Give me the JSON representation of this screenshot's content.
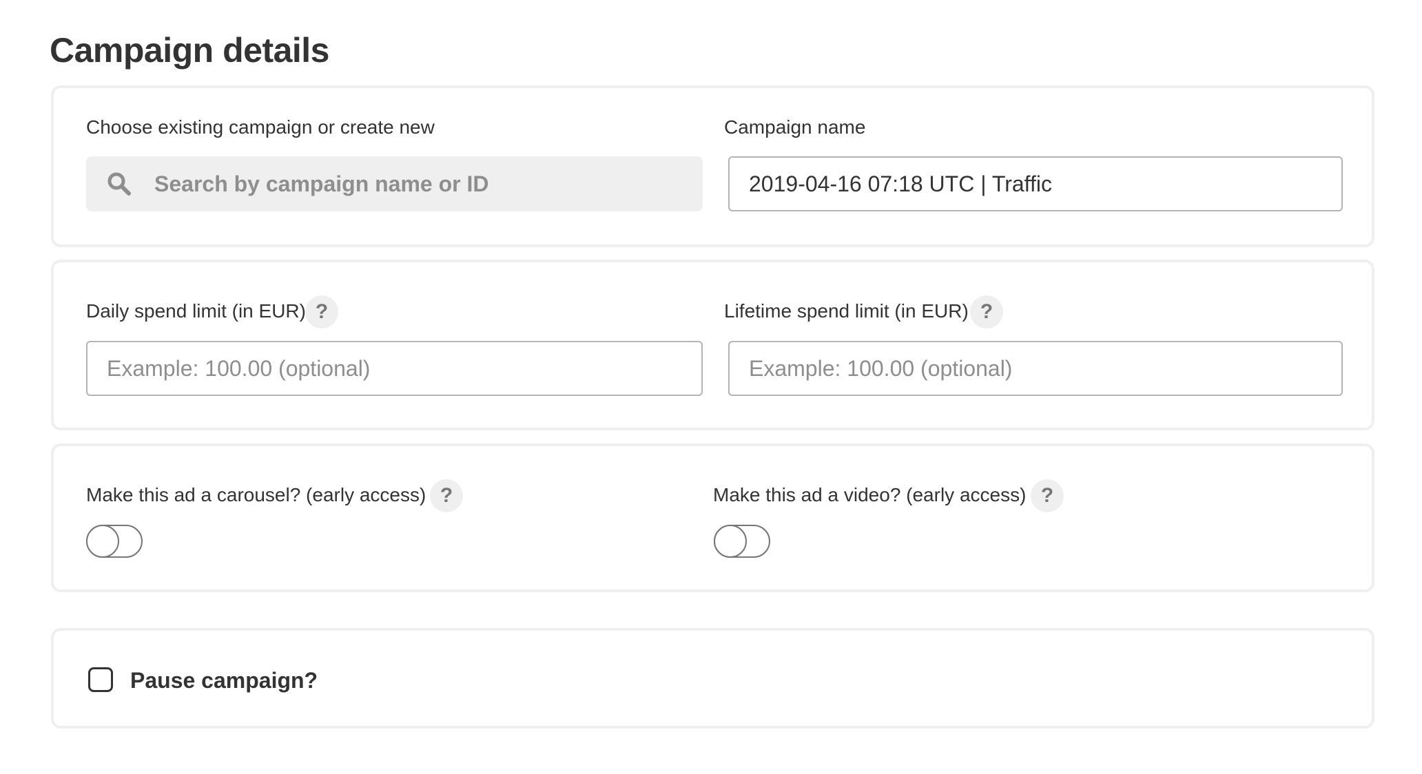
{
  "page": {
    "title": "Campaign details"
  },
  "campaign": {
    "existing_label": "Choose existing campaign or create new",
    "search_placeholder": "Search by campaign name or ID",
    "name_label": "Campaign name",
    "name_value": "2019-04-16 07:18 UTC | Traffic"
  },
  "spend": {
    "daily_label": "Daily spend limit (in EUR)",
    "daily_placeholder": "Example: 100.00 (optional)",
    "daily_value": "",
    "lifetime_label": "Lifetime spend limit (in EUR)",
    "lifetime_placeholder": "Example: 100.00 (optional)",
    "lifetime_value": ""
  },
  "ad_format": {
    "carousel_label": "Make this ad a carousel? (early access)",
    "carousel_enabled": false,
    "video_label": "Make this ad a video? (early access)",
    "video_enabled": false
  },
  "pause": {
    "label": "Pause campaign?",
    "checked": false
  },
  "help_glyph": "?",
  "icons": {
    "search": "search-icon",
    "help": "question-mark-icon"
  },
  "colors": {
    "text": "#333333",
    "muted": "#8e8e8e",
    "field_bg": "#efefef",
    "border": "#b4b4b4",
    "card_border": "#efefef"
  }
}
